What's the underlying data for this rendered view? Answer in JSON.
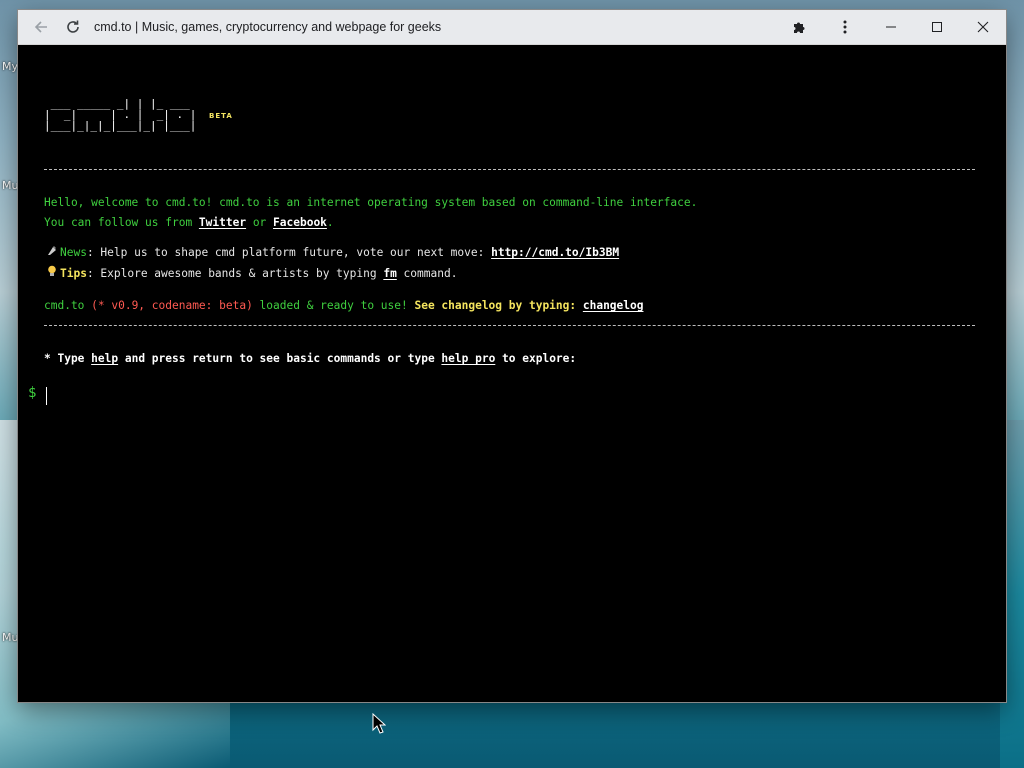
{
  "desktop": {
    "labels": [
      "My",
      "Mu",
      "Mu"
    ]
  },
  "browser": {
    "title": "cmd.to | Music, games, cryptocurrency and webpage for geeks",
    "icons": {
      "back": "arrow-left-icon",
      "reload": "reload-icon",
      "extensions": "puzzle-icon",
      "menu": "kebab-menu-icon",
      "minimize": "minimize-icon",
      "maximize": "maximize-icon",
      "close": "close-icon"
    }
  },
  "terminal": {
    "logo_ascii": " ___ _____ _| | |_ ___\n|  _|     | . |  _| . |\n|___|_|_|_|___|_| |___|",
    "beta_label": "BETA",
    "welcome_line1": "Hello, welcome to cmd.to! cmd.to is an internet operating system based on command-line interface.",
    "welcome_line2_prefix": "You can follow us from ",
    "twitter": "Twitter",
    "or": " or ",
    "facebook": "Facebook",
    "period": ".",
    "news_label": "News",
    "news_text": ": Help us to shape cmd platform future, vote our next move: ",
    "news_link": "http://cmd.to/Ib3BM",
    "tips_label": "Tips",
    "tips_text_a": ": Explore awesome bands & artists by typing ",
    "tips_cmd": "fm",
    "tips_text_b": " command.",
    "status_a": "cmd.to ",
    "status_b": "(* v0.9, codename: beta)",
    "status_c": " loaded & ready to use! ",
    "status_d": "See changelog by typing: ",
    "status_cmd": "changelog",
    "help_a": "* Type ",
    "help_cmd": "help",
    "help_b": " and press return to see basic commands or type ",
    "help_pro": "help pro",
    "help_c": " to explore:",
    "prompt": "$",
    "colors": {
      "green": "#3fcf3f",
      "red": "#ff5a52",
      "yellow": "#f4e45e",
      "background": "#000000"
    }
  }
}
